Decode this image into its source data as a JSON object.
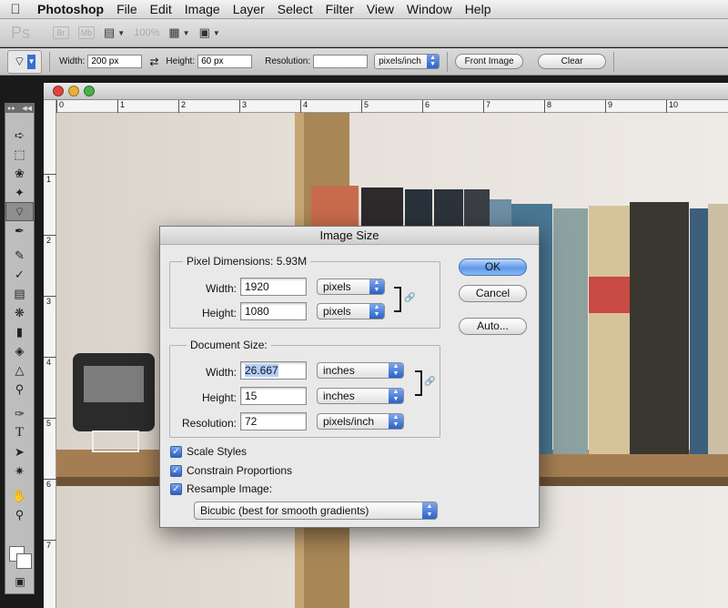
{
  "menubar": {
    "apple_icon": "apple-icon",
    "items": [
      "Photoshop",
      "File",
      "Edit",
      "Image",
      "Layer",
      "Select",
      "Filter",
      "View",
      "Window",
      "Help"
    ]
  },
  "appbar": {
    "logo": "Ps",
    "bridge": "Br",
    "mini_bridge": "Mb",
    "zoom": "100%"
  },
  "options": {
    "width_label": "Width:",
    "width_value": "200 px",
    "height_label": "Height:",
    "height_value": "60 px",
    "resolution_label": "Resolution:",
    "resolution_value": "",
    "unit": "pixels/inch",
    "front_image": "Front Image",
    "clear": "Clear"
  },
  "document": {
    "ruler_top": [
      "0",
      "1",
      "2",
      "3",
      "4",
      "5",
      "6",
      "7",
      "8",
      "9",
      "10"
    ],
    "ruler_left": [
      "1",
      "2",
      "3",
      "4",
      "5",
      "6",
      "7"
    ]
  },
  "dialog": {
    "title": "Image Size",
    "pixel_dimensions_label": "Pixel Dimensions:",
    "pixel_dimensions_size": "5.93M",
    "pixel_width_label": "Width:",
    "pixel_width_value": "1920",
    "pixel_width_unit": "pixels",
    "pixel_height_label": "Height:",
    "pixel_height_value": "1080",
    "pixel_height_unit": "pixels",
    "document_size_label": "Document Size:",
    "doc_width_label": "Width:",
    "doc_width_value": "26.667",
    "doc_width_unit": "inches",
    "doc_height_label": "Height:",
    "doc_height_value": "15",
    "doc_height_unit": "inches",
    "resolution_label": "Resolution:",
    "resolution_value": "72",
    "resolution_unit": "pixels/inch",
    "scale_styles": "Scale Styles",
    "constrain_proportions": "Constrain Proportions",
    "resample_image": "Resample Image:",
    "resample_method": "Bicubic (best for smooth gradients)",
    "ok": "OK",
    "cancel": "Cancel",
    "auto": "Auto..."
  }
}
